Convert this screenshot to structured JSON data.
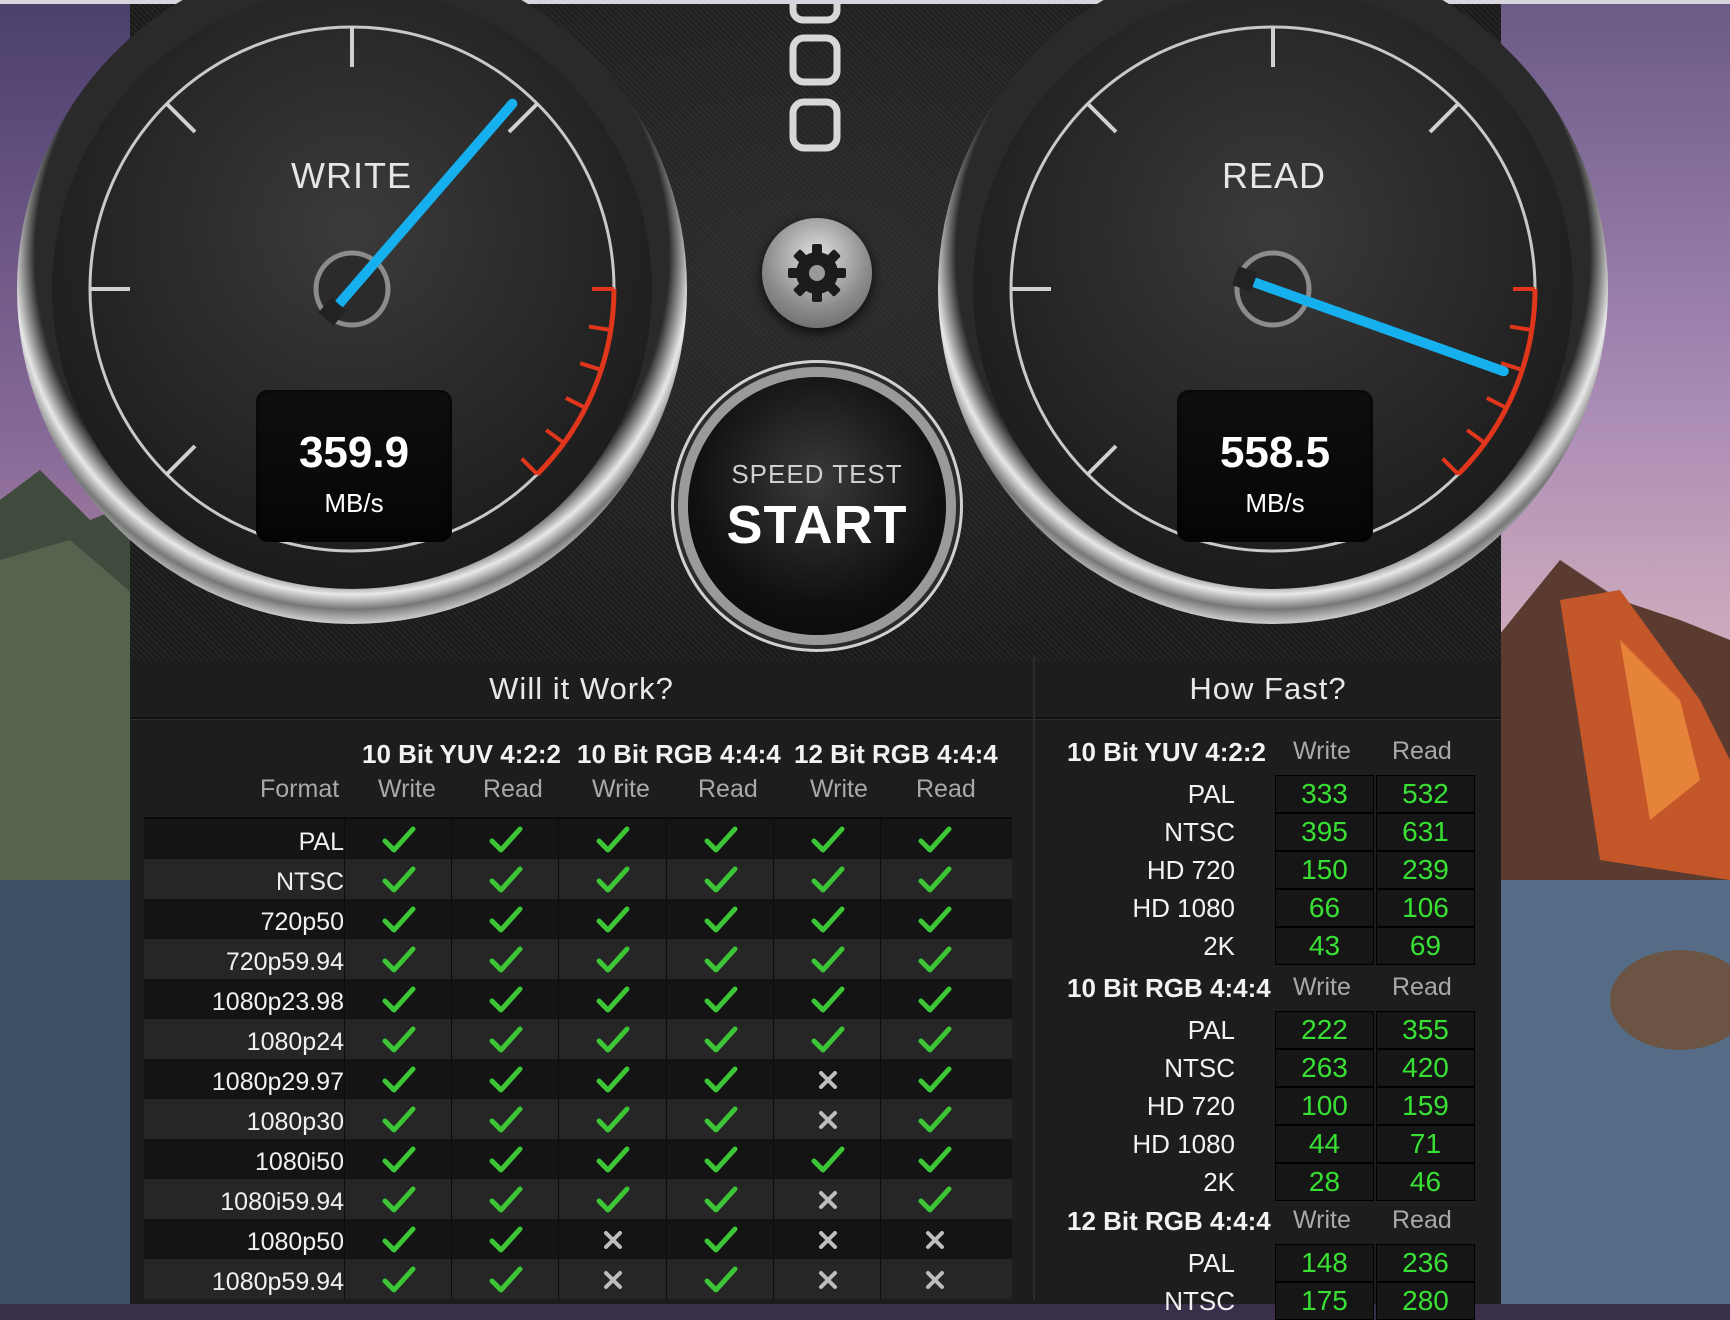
{
  "gauges": {
    "write": {
      "title": "WRITE",
      "value": "359.9",
      "unit": "MB/s"
    },
    "read": {
      "title": "READ",
      "value": "558.5",
      "unit": "MB/s"
    }
  },
  "start_button": {
    "small": "SPEED TEST",
    "big": "START"
  },
  "colors": {
    "needle": "#16b0ef",
    "check": "#3cc636",
    "green_value": "#39e034",
    "redline": "#e0361c"
  },
  "will_it_work": {
    "title": "Will it Work?",
    "format_header": "Format",
    "groups": [
      "10 Bit YUV 4:2:2",
      "10 Bit RGB 4:4:4",
      "12 Bit RGB 4:4:4"
    ],
    "subheaders": [
      "Write",
      "Read",
      "Write",
      "Read",
      "Write",
      "Read"
    ],
    "rows": [
      {
        "format": "PAL",
        "cells": [
          1,
          1,
          1,
          1,
          1,
          1
        ]
      },
      {
        "format": "NTSC",
        "cells": [
          1,
          1,
          1,
          1,
          1,
          1
        ]
      },
      {
        "format": "720p50",
        "cells": [
          1,
          1,
          1,
          1,
          1,
          1
        ]
      },
      {
        "format": "720p59.94",
        "cells": [
          1,
          1,
          1,
          1,
          1,
          1
        ]
      },
      {
        "format": "1080p23.98",
        "cells": [
          1,
          1,
          1,
          1,
          1,
          1
        ]
      },
      {
        "format": "1080p24",
        "cells": [
          1,
          1,
          1,
          1,
          1,
          1
        ]
      },
      {
        "format": "1080p29.97",
        "cells": [
          1,
          1,
          1,
          1,
          0,
          1
        ]
      },
      {
        "format": "1080p30",
        "cells": [
          1,
          1,
          1,
          1,
          0,
          1
        ]
      },
      {
        "format": "1080i50",
        "cells": [
          1,
          1,
          1,
          1,
          1,
          1
        ]
      },
      {
        "format": "1080i59.94",
        "cells": [
          1,
          1,
          1,
          1,
          0,
          1
        ]
      },
      {
        "format": "1080p50",
        "cells": [
          1,
          1,
          0,
          1,
          0,
          0
        ]
      },
      {
        "format": "1080p59.94",
        "cells": [
          1,
          1,
          0,
          1,
          0,
          0
        ]
      }
    ]
  },
  "how_fast": {
    "title": "How Fast?",
    "sections": [
      {
        "header": "10 Bit YUV 4:2:2",
        "write_label": "Write",
        "read_label": "Read",
        "rows": [
          {
            "label": "PAL",
            "write": "333",
            "read": "532"
          },
          {
            "label": "NTSC",
            "write": "395",
            "read": "631"
          },
          {
            "label": "HD 720",
            "write": "150",
            "read": "239"
          },
          {
            "label": "HD 1080",
            "write": "66",
            "read": "106"
          },
          {
            "label": "2K",
            "write": "43",
            "read": "69"
          }
        ]
      },
      {
        "header": "10 Bit RGB 4:4:4",
        "write_label": "Write",
        "read_label": "Read",
        "rows": [
          {
            "label": "PAL",
            "write": "222",
            "read": "355"
          },
          {
            "label": "NTSC",
            "write": "263",
            "read": "420"
          },
          {
            "label": "HD 720",
            "write": "100",
            "read": "159"
          },
          {
            "label": "HD 1080",
            "write": "44",
            "read": "71"
          },
          {
            "label": "2K",
            "write": "28",
            "read": "46"
          }
        ]
      },
      {
        "header": "12 Bit RGB 4:4:4",
        "write_label": "Write",
        "read_label": "Read",
        "rows": [
          {
            "label": "PAL",
            "write": "148",
            "read": "236"
          },
          {
            "label": "NTSC",
            "write": "175",
            "read": "280"
          }
        ]
      }
    ]
  }
}
